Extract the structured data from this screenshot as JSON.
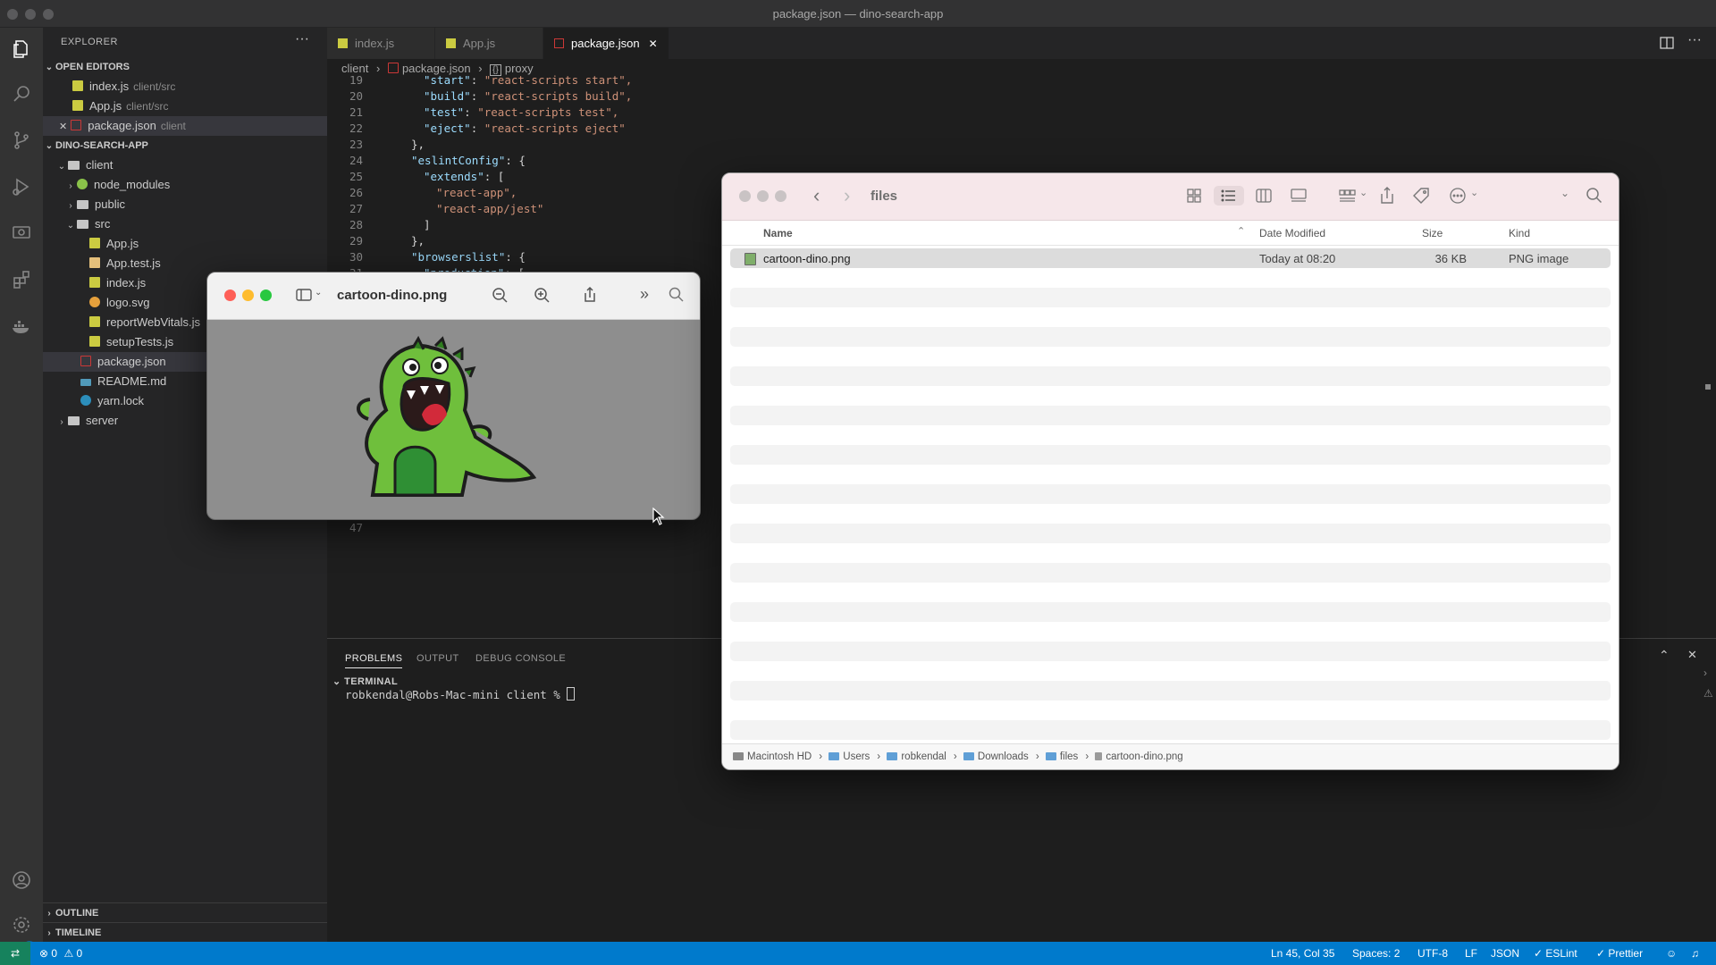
{
  "window": {
    "title": "package.json — dino-search-app"
  },
  "sidebar": {
    "header": "EXPLORER",
    "more": "···",
    "open_editors_title": "OPEN EDITORS",
    "open_editors": [
      {
        "name": "index.js",
        "path": "client/src"
      },
      {
        "name": "App.js",
        "path": "client/src"
      },
      {
        "name": "package.json",
        "path": "client",
        "close": "✕"
      }
    ],
    "project_title": "DINO-SEARCH-APP",
    "tree": [
      {
        "name": "client"
      },
      {
        "name": "node_modules"
      },
      {
        "name": "public"
      },
      {
        "name": "src"
      },
      {
        "name": "App.js"
      },
      {
        "name": "App.test.js"
      },
      {
        "name": "index.js"
      },
      {
        "name": "logo.svg"
      },
      {
        "name": "reportWebVitals.js"
      },
      {
        "name": "setupTests.js"
      },
      {
        "name": "package.json"
      },
      {
        "name": "README.md"
      },
      {
        "name": "yarn.lock"
      },
      {
        "name": "server"
      }
    ],
    "outline": "OUTLINE",
    "timeline": "TIMELINE"
  },
  "tabs": [
    {
      "label": "index.js"
    },
    {
      "label": "App.js"
    },
    {
      "label": "package.json",
      "close": "✕"
    }
  ],
  "breadcrumbs": {
    "part1": "client",
    "part2": "package.json",
    "part3": "proxy"
  },
  "editor": {
    "lines": [
      {
        "num": "19",
        "key": "\"start\"",
        "val": "\"react-scripts start\","
      },
      {
        "num": "20",
        "key": "\"build\"",
        "val": "\"react-scripts build\","
      },
      {
        "num": "21",
        "key": "\"test\"",
        "val": "\"react-scripts test\","
      },
      {
        "num": "22",
        "key": "\"eject\"",
        "val": "\"react-scripts eject\""
      },
      {
        "num": "23",
        "key": "",
        "val": "},"
      },
      {
        "num": "24",
        "key": "\"eslintConfig\"",
        "val": "{"
      },
      {
        "num": "25",
        "key": "\"extends\"",
        "val": "["
      },
      {
        "num": "26",
        "key": "",
        "val": "\"react-app\","
      },
      {
        "num": "27",
        "key": "",
        "val": "\"react-app/jest\""
      },
      {
        "num": "28",
        "key": "",
        "val": "]"
      },
      {
        "num": "29",
        "key": "",
        "val": "},"
      },
      {
        "num": "30",
        "key": "\"browserslist\"",
        "val": "{"
      },
      {
        "num": "31",
        "key": "\"production\"",
        "val": "["
      }
    ],
    "last_line_num": "47"
  },
  "panel": {
    "tabs": [
      "PROBLEMS",
      "OUTPUT",
      "DEBUG CONSOLE"
    ],
    "terminal_title": "TERMINAL",
    "prompt": "robkendal@Robs-Mac-mini client % "
  },
  "status": {
    "errors": "0",
    "warnings": "0",
    "position": "Ln 45, Col 35",
    "spaces": "Spaces: 2",
    "encoding": "UTF-8",
    "eol": "LF",
    "language": "JSON",
    "eslint": "ESLint",
    "prettier": "Prettier"
  },
  "preview": {
    "title": "cartoon-dino.png"
  },
  "finder": {
    "title": "files",
    "columns": {
      "name": "Name",
      "date": "Date Modified",
      "size": "Size",
      "kind": "Kind"
    },
    "files": [
      {
        "name": "cartoon-dino.png",
        "date": "Today at 08:20",
        "size": "36 KB",
        "kind": "PNG image"
      }
    ],
    "path": [
      "Macintosh HD",
      "Users",
      "robkendal",
      "Downloads",
      "files",
      "cartoon-dino.png"
    ]
  },
  "colors": {
    "accent": "#007acc",
    "finder_bar": "#f6e7ea",
    "dino_green": "#6fbf3c"
  }
}
